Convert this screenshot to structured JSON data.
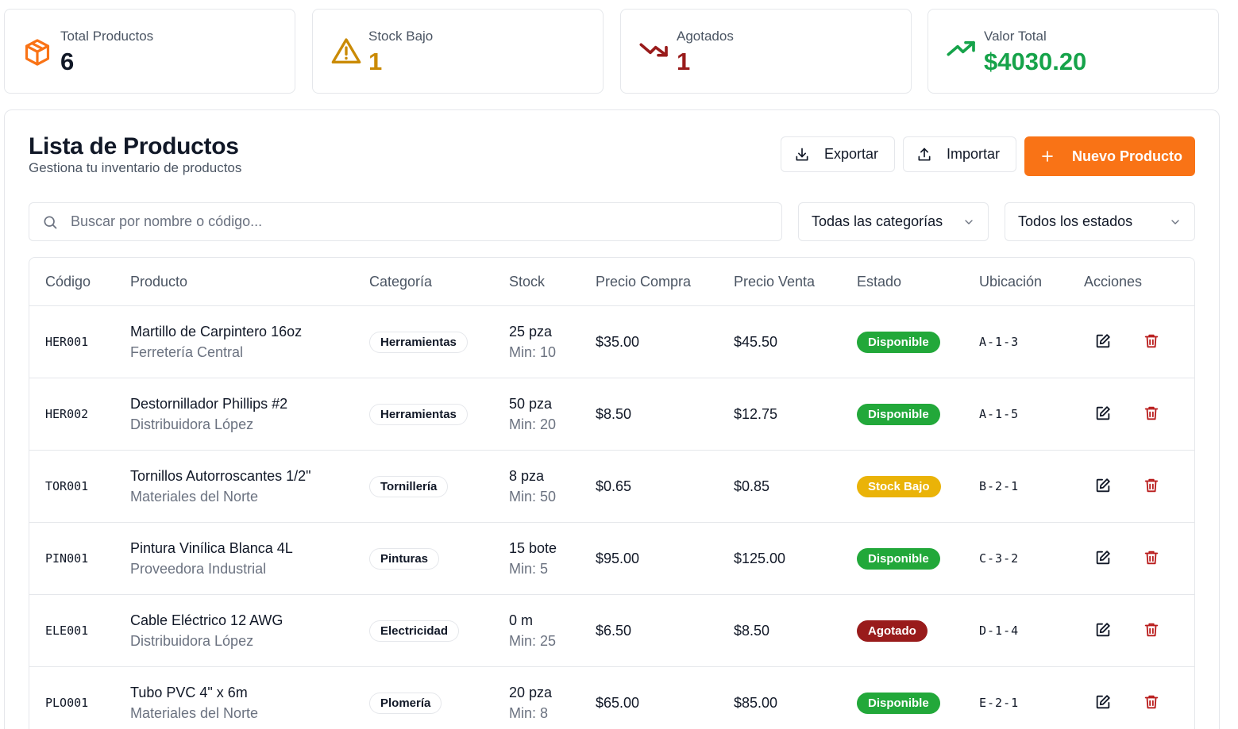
{
  "stats": [
    {
      "label": "Total Productos",
      "value": "6",
      "icon": "package-icon",
      "color": "#111827"
    },
    {
      "label": "Stock Bajo",
      "value": "1",
      "icon": "alert-triangle-icon",
      "color": "#ca8a04"
    },
    {
      "label": "Agotados",
      "value": "1",
      "icon": "trending-down-icon",
      "color": "#991b1b"
    },
    {
      "label": "Valor Total",
      "value": "$4030.20",
      "icon": "trending-up-icon",
      "color": "#16a34a"
    }
  ],
  "header": {
    "title": "Lista de Productos",
    "subtitle": "Gestiona tu inventario de productos",
    "export_label": "Exportar",
    "import_label": "Importar",
    "new_label": "Nuevo Producto"
  },
  "filters": {
    "search_placeholder": "Buscar por nombre o código...",
    "category_selected": "Todas las categorías",
    "status_selected": "Todos los estados"
  },
  "table": {
    "columns": [
      "Código",
      "Producto",
      "Categoría",
      "Stock",
      "Precio Compra",
      "Precio Venta",
      "Estado",
      "Ubicación",
      "Acciones"
    ],
    "rows": [
      {
        "code": "HER001",
        "name": "Martillo de Carpintero 16oz",
        "supplier": "Ferretería Central",
        "category": "Herramientas",
        "stock": "25 pza",
        "min": "Min: 10",
        "buy": "$35.00",
        "sell": "$45.50",
        "status": "Disponible",
        "status_color": "#22a83a",
        "location": "A-1-3"
      },
      {
        "code": "HER002",
        "name": "Destornillador Phillips #2",
        "supplier": "Distribuidora López",
        "category": "Herramientas",
        "stock": "50 pza",
        "min": "Min: 20",
        "buy": "$8.50",
        "sell": "$12.75",
        "status": "Disponible",
        "status_color": "#22a83a",
        "location": "A-1-5"
      },
      {
        "code": "TOR001",
        "name": "Tornillos Autorroscantes 1/2\"",
        "supplier": "Materiales del Norte",
        "category": "Tornillería",
        "stock": "8 pza",
        "min": "Min: 50",
        "buy": "$0.65",
        "sell": "$0.85",
        "status": "Stock Bajo",
        "status_color": "#eab308",
        "location": "B-2-1"
      },
      {
        "code": "PIN001",
        "name": "Pintura Vinílica Blanca 4L",
        "supplier": "Proveedora Industrial",
        "category": "Pinturas",
        "stock": "15 bote",
        "min": "Min: 5",
        "buy": "$95.00",
        "sell": "$125.00",
        "status": "Disponible",
        "status_color": "#22a83a",
        "location": "C-3-2"
      },
      {
        "code": "ELE001",
        "name": "Cable Eléctrico 12 AWG",
        "supplier": "Distribuidora López",
        "category": "Electricidad",
        "stock": "0 m",
        "min": "Min: 25",
        "buy": "$6.50",
        "sell": "$8.50",
        "status": "Agotado",
        "status_color": "#991b1b",
        "location": "D-1-4"
      },
      {
        "code": "PLO001",
        "name": "Tubo PVC 4\" x 6m",
        "supplier": "Materiales del Norte",
        "category": "Plomería",
        "stock": "20 pza",
        "min": "Min: 8",
        "buy": "$65.00",
        "sell": "$85.00",
        "status": "Disponible",
        "status_color": "#22a83a",
        "location": "E-2-1"
      }
    ]
  },
  "colors": {
    "accent": "#f97316",
    "danger": "#b91c1c"
  }
}
